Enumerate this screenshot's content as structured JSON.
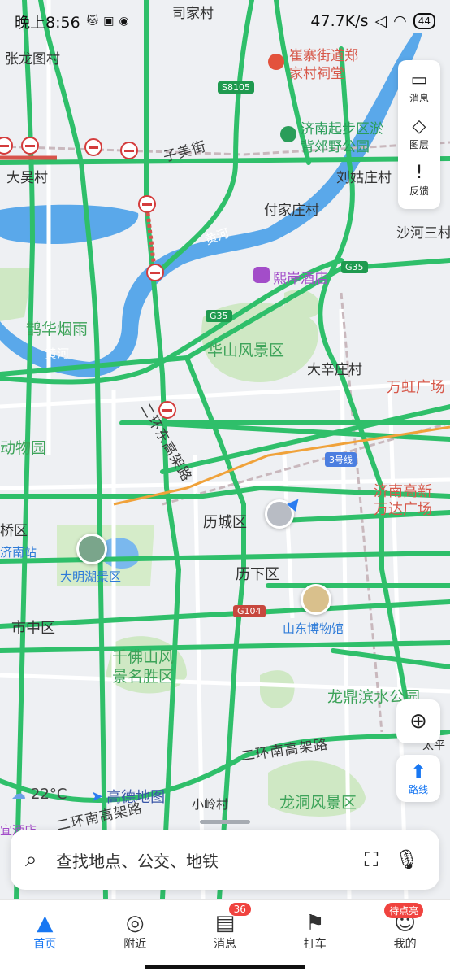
{
  "status": {
    "time": "晚上8:56",
    "speed": "47.7K/s",
    "battery": "44"
  },
  "side_panel": {
    "messages": "消息",
    "layers": "图层",
    "feedback": "反馈"
  },
  "map_labels": {
    "sijiacun": "司家村",
    "zhanglongtu": "张龙图村",
    "cuizhai": "崔寨街道郑\n家村祠堂",
    "jinan_qibu": "济南起步区淤\n背郊野公园",
    "zimei": "子美街",
    "dawu": "大吴村",
    "liuguzhuang": "刘姑庄村",
    "fujiazhuang": "付家庄村",
    "shahe": "沙河三村",
    "huanghe1": "黄河",
    "huanghe2": "黄河",
    "xian_hotel": "熙岸酒店",
    "quehua": "鹊华烟雨",
    "huashan": "华山风景区",
    "daxinzhuang": "大辛庄村",
    "wanhong": "万虹广场",
    "erhuan_east": "二环东高架路",
    "dongwuyuan": "动物园",
    "line3": "3号线",
    "wanda": "济南高新\n万达广场",
    "qiaoqu": "桥区",
    "lichengqu": "历城区",
    "jinan_station": "济南站",
    "daming_lake": "大明湖景区",
    "lixia": "历下区",
    "shizhong": "市中区",
    "shandong_museum": "山东博物馆",
    "qianfo": "千佛山风\n景名胜区",
    "longding": "龙鼎滨水公园",
    "erhuan_south1": "二环南高架路",
    "erhuan_south2": "二环南高架路",
    "longdong": "龙洞风景区",
    "xiaoling": "小岭村",
    "yihotel": "宜酒店",
    "taiping": "太平"
  },
  "shields": {
    "s8105": "S8105",
    "g35a": "G35",
    "g35b": "G35",
    "g104": "G104"
  },
  "weather": {
    "temp": "22°C",
    "brand": "高德地图"
  },
  "search": {
    "placeholder": "查找地点、公交、地铁"
  },
  "route_button": "路线",
  "tabs": [
    {
      "label": "首页",
      "icon": "navigation-arrow-icon"
    },
    {
      "label": "附近",
      "icon": "location-pin-icon"
    },
    {
      "label": "消息",
      "icon": "chat-bubble-icon",
      "badge": "36"
    },
    {
      "label": "打车",
      "icon": "taxi-flag-icon"
    },
    {
      "label": "我的",
      "icon": "profile-icon",
      "badge": "待点亮"
    }
  ],
  "colors": {
    "road": "#2fbf6a",
    "water": "#5aa8ea",
    "park": "#cfe8c4",
    "accent": "#1877f2",
    "badge": "#f0433f"
  }
}
